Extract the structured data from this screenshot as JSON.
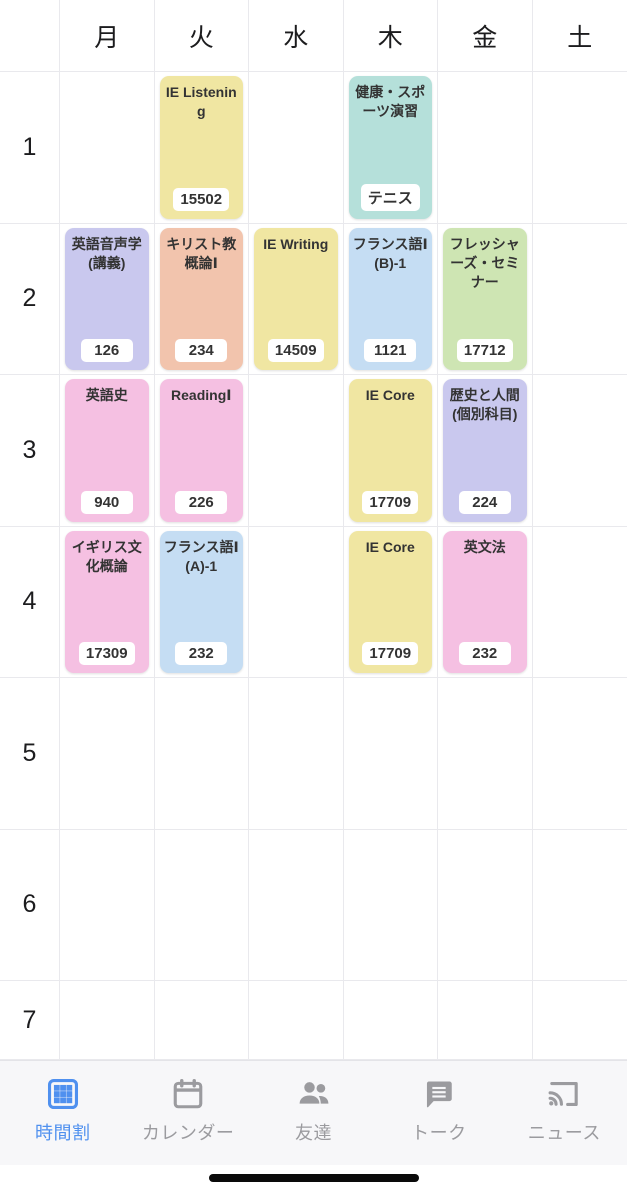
{
  "header": {
    "corner_label": "",
    "days": [
      "月",
      "火",
      "水",
      "木",
      "金",
      "土"
    ]
  },
  "periods": [
    "1",
    "2",
    "3",
    "4",
    "5",
    "6",
    "7"
  ],
  "colors": {
    "yellow": "#f0e6a2",
    "teal": "#b5e0da",
    "purple": "#c9c8ee",
    "peach": "#f2c4ad",
    "blue": "#c5ddf3",
    "green": "#cee5b3",
    "pink": "#f5c0e2",
    "accent": "#4f90ef",
    "inactive": "#9b9b9f",
    "gridline": "#e9e9ed",
    "tabbar_bg": "#f7f7f9"
  },
  "entries": [
    {
      "period": 1,
      "day": 1,
      "title": "IE Listening",
      "code": "15502",
      "color": "#f0e6a2"
    },
    {
      "period": 1,
      "day": 3,
      "title": "健康・スポーツ演習",
      "code": "テニス",
      "color": "#b5e0da"
    },
    {
      "period": 2,
      "day": 0,
      "title": "英語音声学(講義)",
      "code": "126",
      "color": "#c9c8ee"
    },
    {
      "period": 2,
      "day": 1,
      "title": "キリスト教概論Ⅰ",
      "code": "234",
      "color": "#f2c4ad"
    },
    {
      "period": 2,
      "day": 2,
      "title": "IE Writing",
      "code": "14509",
      "color": "#f0e6a2"
    },
    {
      "period": 2,
      "day": 3,
      "title": "フランス語Ⅰ(B)-1",
      "code": "1121",
      "color": "#c5ddf3"
    },
    {
      "period": 2,
      "day": 4,
      "title": "フレッシャーズ・セミナー",
      "code": "17712",
      "color": "#cee5b3"
    },
    {
      "period": 3,
      "day": 0,
      "title": "英語史",
      "code": "940",
      "color": "#f5c0e2"
    },
    {
      "period": 3,
      "day": 1,
      "title": "ReadingⅠ",
      "code": "226",
      "color": "#f5c0e2"
    },
    {
      "period": 3,
      "day": 3,
      "title": "IE Core",
      "code": "17709",
      "color": "#f0e6a2"
    },
    {
      "period": 3,
      "day": 4,
      "title": "歴史と人間(個別科目)",
      "code": "224",
      "color": "#c9c8ee"
    },
    {
      "period": 4,
      "day": 0,
      "title": "イギリス文化概論",
      "code": "17309",
      "color": "#f5c0e2"
    },
    {
      "period": 4,
      "day": 1,
      "title": "フランス語Ⅰ(A)-1",
      "code": "232",
      "color": "#c5ddf3"
    },
    {
      "period": 4,
      "day": 3,
      "title": "IE Core",
      "code": "17709",
      "color": "#f0e6a2"
    },
    {
      "period": 4,
      "day": 4,
      "title": "英文法",
      "code": "232",
      "color": "#f5c0e2"
    }
  ],
  "tabbar": {
    "items": [
      {
        "label": "時間割",
        "icon": "grid-icon",
        "active": true
      },
      {
        "label": "カレンダー",
        "icon": "calendar-icon",
        "active": false
      },
      {
        "label": "友達",
        "icon": "people-icon",
        "active": false
      },
      {
        "label": "トーク",
        "icon": "chat-icon",
        "active": false
      },
      {
        "label": "ニュース",
        "icon": "cast-icon",
        "active": false
      }
    ]
  }
}
